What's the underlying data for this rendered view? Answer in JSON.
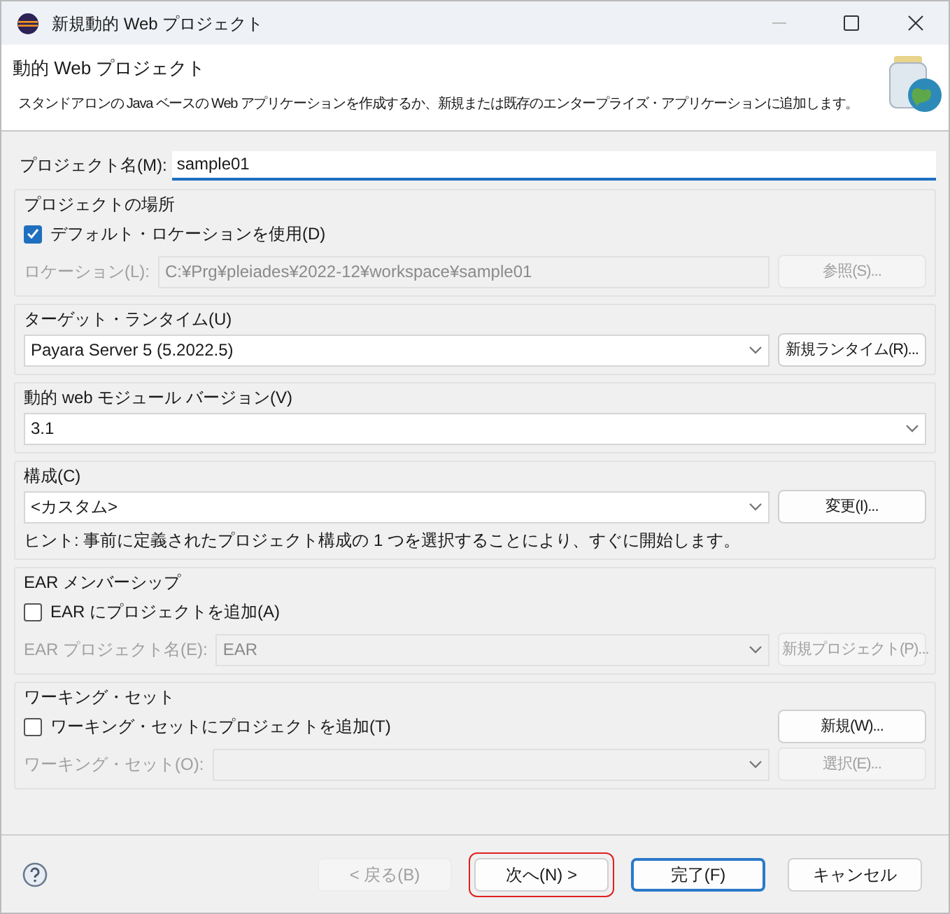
{
  "window": {
    "title": "新規動的 Web プロジェクト"
  },
  "header": {
    "title": "動的 Web プロジェクト",
    "description": "スタンドアロンの Java ベースの Web アプリケーションを作成するか、新規または既存のエンタープライズ・アプリケーションに追加します。"
  },
  "project_name": {
    "label": "プロジェクト名(M):",
    "value": "sample01"
  },
  "groups": [
    {
      "title": "プロジェクトの場所",
      "rows": [
        {
          "kind": "checkbox",
          "label": "デフォルト・ロケーションを使用(D)",
          "checked": true
        },
        {
          "kind": "field",
          "label": "ロケーション(L):",
          "value": "C:¥Prg¥pleiades¥2022-12¥workspace¥sample01",
          "disabled": true,
          "button": {
            "label": "参照(S)...",
            "disabled": true
          }
        }
      ]
    },
    {
      "title": "ターゲット・ランタイム(U)",
      "rows": [
        {
          "kind": "combo",
          "value": "Payara Server 5 (5.2022.5)",
          "disabled": false,
          "button": {
            "label": "新規ランタイム(R)...",
            "disabled": false
          }
        }
      ]
    },
    {
      "title": "動的 web モジュール バージョン(V)",
      "rows": [
        {
          "kind": "combo",
          "value": "3.1",
          "disabled": false
        }
      ]
    },
    {
      "title": "構成(C)",
      "rows": [
        {
          "kind": "combo",
          "value": "<カスタム>",
          "disabled": false,
          "button": {
            "label": "変更(I)...",
            "disabled": false
          }
        },
        {
          "kind": "hint",
          "label": "ヒント: 事前に定義されたプロジェクト構成の 1 つを選択することにより、すぐに開始します。"
        }
      ]
    },
    {
      "title": "EAR メンバーシップ",
      "rows": [
        {
          "kind": "checkbox",
          "label": "EAR にプロジェクトを追加(A)",
          "checked": false
        },
        {
          "kind": "combo",
          "label": "EAR プロジェクト名(E):",
          "value": "EAR",
          "disabled": true,
          "button": {
            "label": "新規プロジェクト(P)...",
            "disabled": true
          }
        }
      ]
    },
    {
      "title": "ワーキング・セット",
      "rows": [
        {
          "kind": "checkbox",
          "label": "ワーキング・セットにプロジェクトを追加(T)",
          "checked": false,
          "button": {
            "label": "新規(W)...",
            "disabled": false
          }
        },
        {
          "kind": "combo",
          "label": "ワーキング・セット(O):",
          "disabled": true,
          "button": {
            "label": "選択(E)...",
            "disabled": true
          }
        }
      ]
    }
  ],
  "footer_buttons": [
    {
      "label": "< 戻る(B)",
      "disabled": true,
      "default": false,
      "highlighted": false
    },
    {
      "label": "次へ(N) >",
      "disabled": false,
      "default": false,
      "highlighted": true
    },
    {
      "label": "完了(F)",
      "disabled": false,
      "default": true,
      "highlighted": false
    },
    {
      "label": "キャンセル",
      "disabled": false,
      "default": false,
      "highlighted": false
    }
  ]
}
